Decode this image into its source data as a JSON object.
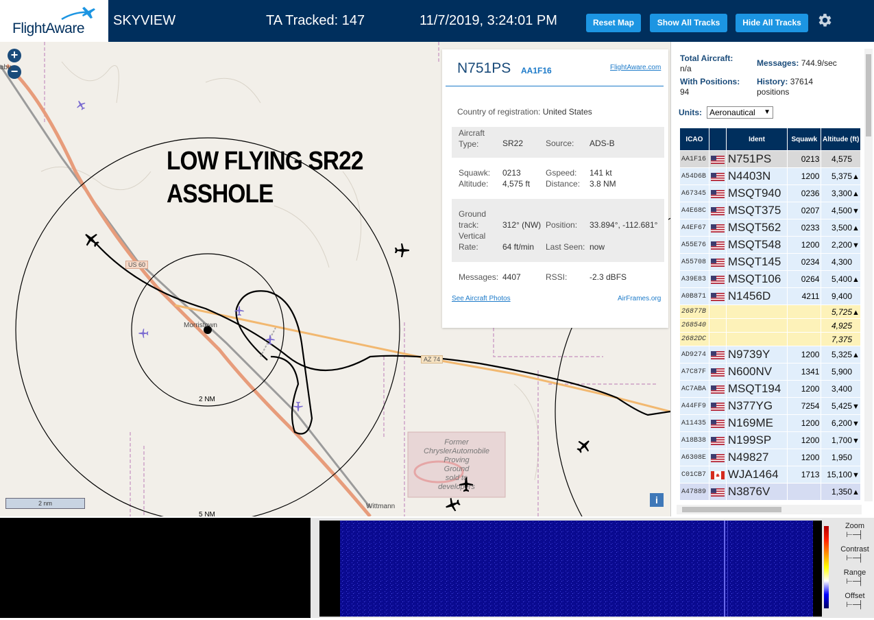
{
  "header": {
    "logo_text": "FlightAware",
    "app_name": "SKYVIEW",
    "tracked": "TA Tracked: 147",
    "datetime": "11/7/2019, 3:24:01 PM",
    "btn_reset": "Reset Map",
    "btn_show": "Show All Tracks",
    "btn_hide": "Hide All Tracks",
    "colors": {
      "bar": "#002f5d",
      "button": "#1c95e2"
    }
  },
  "map": {
    "zoom_in": "+",
    "zoom_out": "−",
    "annotation_line1": "LOW FLYING SR22",
    "annotation_line2": "ASSHOLE",
    "scale_label": "2 nm",
    "ring_inner_label": "2 NM",
    "ring_outer_label": "5 NM",
    "road_us60": "US 60",
    "road_az74": "AZ 74",
    "town1": "Morristown",
    "town2": "Wittmann",
    "town3": "abu",
    "area_label": [
      "Former",
      "ChryslerAutomobile",
      "Proving",
      "Ground",
      "sold to",
      "developers"
    ],
    "info_btn": "i"
  },
  "popup": {
    "registration": "N751PS",
    "hex": "AA1F16",
    "fa_link": "FlightAware.com",
    "country_label": "Country of registration:",
    "country": "United States",
    "aircraft_type_label": "Aircraft Type:",
    "aircraft_type_label_1": "Aircraft",
    "aircraft_type_label_2": "Type:",
    "aircraft_type": "SR22",
    "source_label": "Source:",
    "source": "ADS-B",
    "squawk_label": "Squawk:",
    "squawk": "0213",
    "gspeed_label": "Gspeed:",
    "gspeed": "141 kt",
    "altitude_label": "Altitude:",
    "altitude": "4,575 ft",
    "distance_label": "Distance:",
    "distance": "3.8 NM",
    "track_label_1": "Ground",
    "track_label_2": "track:",
    "track": "312° (NW)",
    "position_label": "Position:",
    "position": "33.894°, -112.681°",
    "vrate_label_1": "Vertical",
    "vrate_label_2": "Rate:",
    "vrate": "64 ft/min",
    "lastseen_label": "Last Seen:",
    "lastseen": "now",
    "messages_label": "Messages:",
    "messages": "4407",
    "rssi_label": "RSSI:",
    "rssi": "-2.3 dBFS",
    "photos_link": "See Aircraft Photos",
    "airframes_link": "AirFrames.org"
  },
  "panel": {
    "total_label": "Total Aircraft:",
    "total": "n/a",
    "messages_label": "Messages:",
    "messages": "744.9/sec",
    "with_pos_label": "With Positions:",
    "with_pos": "94",
    "history_label": "History:",
    "history": "37614 positions",
    "units_label": "Units:",
    "units_value": "Aeronautical",
    "columns": [
      "ICAO",
      "",
      "Ident",
      "Squawk",
      "Altitude (ft)"
    ],
    "rows": [
      {
        "icao": "AA1F16",
        "flag": "us",
        "ident": "N751PS",
        "squawk": "0213",
        "alt": "4,575",
        "trend": "",
        "style": "sel"
      },
      {
        "icao": "A54D6B",
        "flag": "us",
        "ident": "N4403N",
        "squawk": "1200",
        "alt": "5,375",
        "trend": "▲",
        "style": "r"
      },
      {
        "icao": "A67345",
        "flag": "us",
        "ident": "MSQT940",
        "squawk": "0236",
        "alt": "3,300",
        "trend": "▲",
        "style": "r"
      },
      {
        "icao": "A4E68C",
        "flag": "us",
        "ident": "MSQT375",
        "squawk": "0207",
        "alt": "4,500",
        "trend": "▼",
        "style": "r"
      },
      {
        "icao": "A4EF67",
        "flag": "us",
        "ident": "MSQT562",
        "squawk": "0233",
        "alt": "3,500",
        "trend": "▲",
        "style": "r"
      },
      {
        "icao": "A55E76",
        "flag": "us",
        "ident": "MSQT548",
        "squawk": "1200",
        "alt": "2,200",
        "trend": "▼",
        "style": "r"
      },
      {
        "icao": "A55708",
        "flag": "us",
        "ident": "MSQT145",
        "squawk": "0234",
        "alt": "4,300",
        "trend": "",
        "style": "r"
      },
      {
        "icao": "A39E83",
        "flag": "us",
        "ident": "MSQT106",
        "squawk": "0264",
        "alt": "5,400",
        "trend": "▲",
        "style": "r"
      },
      {
        "icao": "A0B871",
        "flag": "us",
        "ident": "N1456D",
        "squawk": "4211",
        "alt": "9,400",
        "trend": "",
        "style": "r"
      },
      {
        "icao": "26877B",
        "flag": "",
        "ident": "",
        "squawk": "",
        "alt": "5,725",
        "trend": "▲",
        "style": "y"
      },
      {
        "icao": "268540",
        "flag": "",
        "ident": "",
        "squawk": "",
        "alt": "4,925",
        "trend": "",
        "style": "y"
      },
      {
        "icao": "2682DC",
        "flag": "",
        "ident": "",
        "squawk": "",
        "alt": "7,375",
        "trend": "",
        "style": "y"
      },
      {
        "icao": "AD9274",
        "flag": "us",
        "ident": "N9739Y",
        "squawk": "1200",
        "alt": "5,325",
        "trend": "▲",
        "style": "r"
      },
      {
        "icao": "A7C87F",
        "flag": "us",
        "ident": "N600NV",
        "squawk": "1341",
        "alt": "5,900",
        "trend": "",
        "style": "r"
      },
      {
        "icao": "AC7ABA",
        "flag": "us",
        "ident": "MSQT194",
        "squawk": "1200",
        "alt": "3,400",
        "trend": "",
        "style": "r"
      },
      {
        "icao": "A44FF9",
        "flag": "us",
        "ident": "N377YG",
        "squawk": "7254",
        "alt": "5,425",
        "trend": "▼",
        "style": "r"
      },
      {
        "icao": "A11435",
        "flag": "us",
        "ident": "N169ME",
        "squawk": "1200",
        "alt": "6,200",
        "trend": "▼",
        "style": "r"
      },
      {
        "icao": "A18B38",
        "flag": "us",
        "ident": "N199SP",
        "squawk": "1200",
        "alt": "1,700",
        "trend": "▼",
        "style": "r"
      },
      {
        "icao": "A6308E",
        "flag": "us",
        "ident": "N49827",
        "squawk": "1200",
        "alt": "1,950",
        "trend": "",
        "style": "r"
      },
      {
        "icao": "C01CB7",
        "flag": "ca",
        "ident": "WJA1464",
        "squawk": "1713",
        "alt": "15,100",
        "trend": "▼",
        "style": "r"
      },
      {
        "icao": "A47889",
        "flag": "us",
        "ident": "N3876V",
        "squawk": "",
        "alt": "1,350",
        "trend": "▲",
        "style": "last"
      }
    ]
  },
  "spectrum": {
    "zoom_label": "Zoom",
    "contrast_label": "Contrast",
    "range_label": "Range",
    "offset_label": "Offset"
  }
}
